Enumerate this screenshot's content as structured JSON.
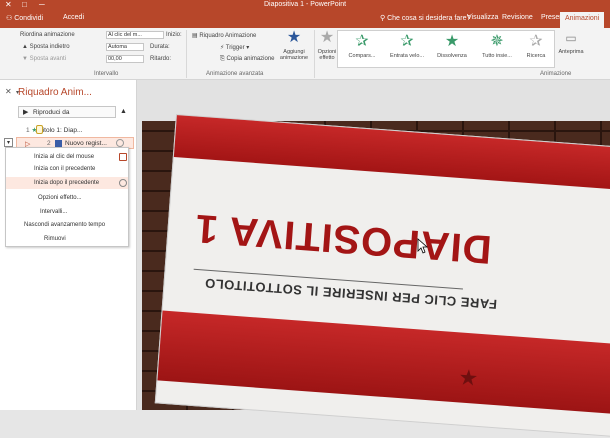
{
  "window": {
    "title": "Diapositiva 1 - PowerPoint",
    "controls": [
      "─",
      "□",
      "✕"
    ]
  },
  "tabs": {
    "login": "Accedi",
    "share": "Condividi",
    "tell_me": "Che cosa si desidera fare?",
    "items": [
      "Visualizza",
      "Revisione",
      "Presentazione",
      "Animazioni"
    ],
    "active": "Animazioni"
  },
  "ribbon": {
    "timing": {
      "start_label": "Inizio:",
      "start_value": "Al clic del m...",
      "duration_label": "Durata:",
      "duration_value": "Automa",
      "delay_label": "Ritardo:",
      "delay_value": "00,00",
      "reorder_label": "Riordina animazione",
      "move_earlier": "Sposta indietro",
      "move_later": "Sposta avanti",
      "group": "Intervallo"
    },
    "advanced": {
      "animation_pane": "Riquadro Animazione",
      "trigger": "Trigger",
      "painter": "Copia animazione",
      "add_animation": "Aggiungi animazione",
      "group": "Animazione avanzata"
    },
    "effect_options": "Opzioni effetto",
    "gallery": {
      "items": [
        "Compars...",
        "Entrata velo...",
        "Dissolvenza",
        "Tutto insie...",
        "Ricerca"
      ],
      "group": "Animazione"
    },
    "preview": "Anteprima"
  },
  "pane": {
    "title": "Riquadro Anim...",
    "play_label": "Riproduci da",
    "entries": [
      {
        "num": "1",
        "label": "Titolo 1: Diap..."
      },
      {
        "num": "2",
        "label": "Nuovo regist..."
      }
    ],
    "menu": [
      "Inizia al clic del mouse",
      "Inizia con il precedente",
      "Inizia dopo il precedente",
      "Opzioni effetto...",
      "Intervalli...",
      "Nascondi avanzamento tempo",
      "Rimuovi"
    ]
  },
  "slide": {
    "title": "DIAPOSITIVA 1",
    "subtitle": "FARE CLIC PER INSERIRE IL SOTTOTITOLO"
  },
  "colors": {
    "accent": "#b7472a",
    "slide_red": "#a31515"
  }
}
